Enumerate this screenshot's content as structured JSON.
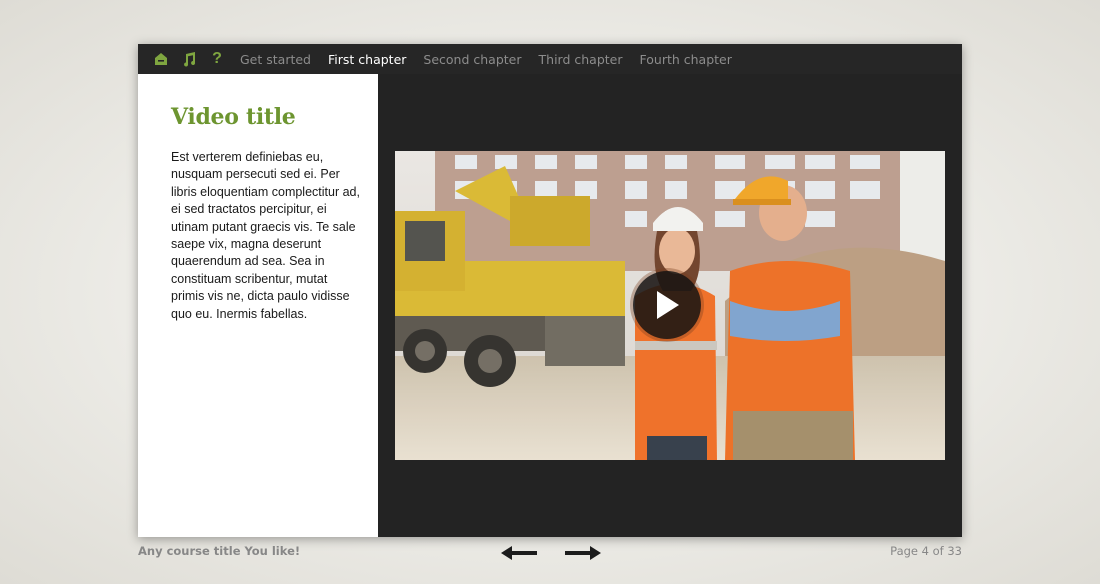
{
  "toolbar": {
    "icons": [
      "home-icon",
      "music-icon",
      "help-icon"
    ],
    "help_glyph": "?",
    "accent_color": "#7fa640"
  },
  "nav": {
    "items": [
      {
        "label": "Get started",
        "active": false
      },
      {
        "label": "First chapter",
        "active": true
      },
      {
        "label": "Second chapter",
        "active": false
      },
      {
        "label": "Third chapter",
        "active": false
      },
      {
        "label": "Fourth chapter",
        "active": false
      }
    ]
  },
  "content": {
    "title": "Video title",
    "title_color": "#6d9530",
    "body": "Est verterem definiebas eu, nusquam persecuti sed ei. Per libris eloquentiam complectitur ad, ei sed tractatos percipitur, ei utinam putant graecis vis. Te sale saepe vix, magna deserunt quaerendum ad sea. Sea in constituam scribentur, mutat primis vis ne, dicta paulo vidisse quo eu. Inermis fabellas."
  },
  "video": {
    "play_icon": "play-icon"
  },
  "footer": {
    "course_title": "Any course title You like!",
    "page_label": "Page 4 of 33",
    "prev_icon": "arrow-left-icon",
    "next_icon": "arrow-right-icon"
  }
}
